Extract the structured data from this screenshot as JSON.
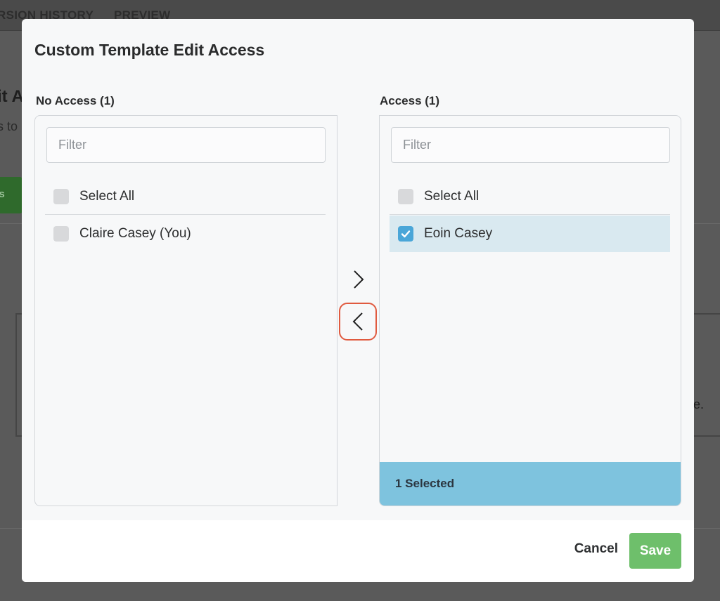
{
  "background": {
    "tabs": [
      "RSION HISTORY",
      "PREVIEW"
    ],
    "heading": "it A",
    "subtext": "s to",
    "button_label": "ss",
    "trailing_char": "e."
  },
  "modal": {
    "title": "Custom Template Edit Access",
    "left": {
      "label": "No Access (1)",
      "filter_placeholder": "Filter",
      "select_all": "Select All",
      "items": [
        {
          "label": "Claire Casey (You)",
          "checked": false
        }
      ]
    },
    "right": {
      "label": "Access (1)",
      "filter_placeholder": "Filter",
      "select_all": "Select All",
      "items": [
        {
          "label": "Eoin Casey",
          "checked": true
        }
      ],
      "selected_count_text": "1 Selected"
    },
    "footer": {
      "cancel_label": "Cancel",
      "save_label": "Save"
    }
  },
  "colors": {
    "accent_blue": "#7ec3de",
    "checkbox_checked": "#4aa6d8",
    "selected_row": "#d9e9f0",
    "save_green": "#6ebf6b",
    "highlight_outline": "#e05a3f"
  },
  "icons": {
    "move_right": "chevron-right-icon",
    "move_left": "chevron-left-icon",
    "check": "check-icon"
  }
}
